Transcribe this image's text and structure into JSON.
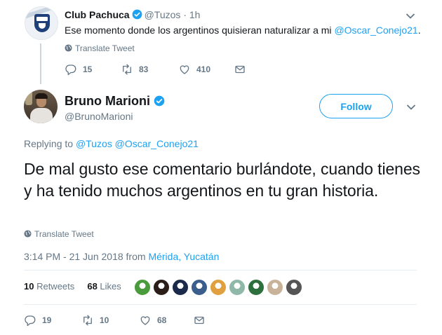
{
  "parent_tweet": {
    "name": "Club Pachuca",
    "handle": "@Tuzos",
    "time": "· 1h",
    "text_before": "Ese momento donde los argentinos quisieran naturalizar a mi ",
    "text_mention": "@Oscar_Conejo21",
    "text_after": ".",
    "translate": "Translate Tweet",
    "replies": "15",
    "retweets": "83",
    "likes": "410"
  },
  "main_tweet": {
    "name": "Bruno Marioni",
    "handle": "@BrunoMarioni",
    "follow_label": "Follow",
    "replying_prefix": "Replying to ",
    "replying_to": [
      "@Tuzos",
      "@Oscar_Conejo21"
    ],
    "text": "De mal gusto ese comentario burlándote, cuando tienes y ha tenido muchos argentinos en tu gran historia.",
    "translate": "Translate Tweet",
    "timestamp": "3:14 PM - 21 Jun 2018",
    "from_word": " from ",
    "location": "Mérida, Yucatán",
    "retweet_count": "10",
    "retweet_label": " Retweets",
    "like_count": "68",
    "like_label": " Likes",
    "replies": "19",
    "retweets": "10",
    "likes": "68"
  },
  "liker_avatars": [
    {
      "name": "liker-avatar-1",
      "color": "#4a9b3c"
    },
    {
      "name": "liker-avatar-2",
      "color": "#2b1d18"
    },
    {
      "name": "liker-avatar-3",
      "color": "#1b2a4a"
    },
    {
      "name": "liker-avatar-4",
      "color": "#3b5e8c"
    },
    {
      "name": "liker-avatar-5",
      "color": "#e0a040"
    },
    {
      "name": "liker-avatar-6",
      "color": "#8fb8a8"
    },
    {
      "name": "liker-avatar-7",
      "color": "#2e6f3e"
    },
    {
      "name": "liker-avatar-8",
      "color": "#c9b29a"
    },
    {
      "name": "liker-avatar-9",
      "color": "#555555"
    }
  ],
  "colors": {
    "accent": "#1da1f2",
    "secondary_text": "#657786",
    "primary_text": "#14171a",
    "divider": "#e6ecf0"
  },
  "icons": [
    "verified-icon",
    "globe-icon",
    "reply-icon",
    "retweet-icon",
    "like-icon",
    "dm-icon",
    "chevron-down-icon"
  ]
}
